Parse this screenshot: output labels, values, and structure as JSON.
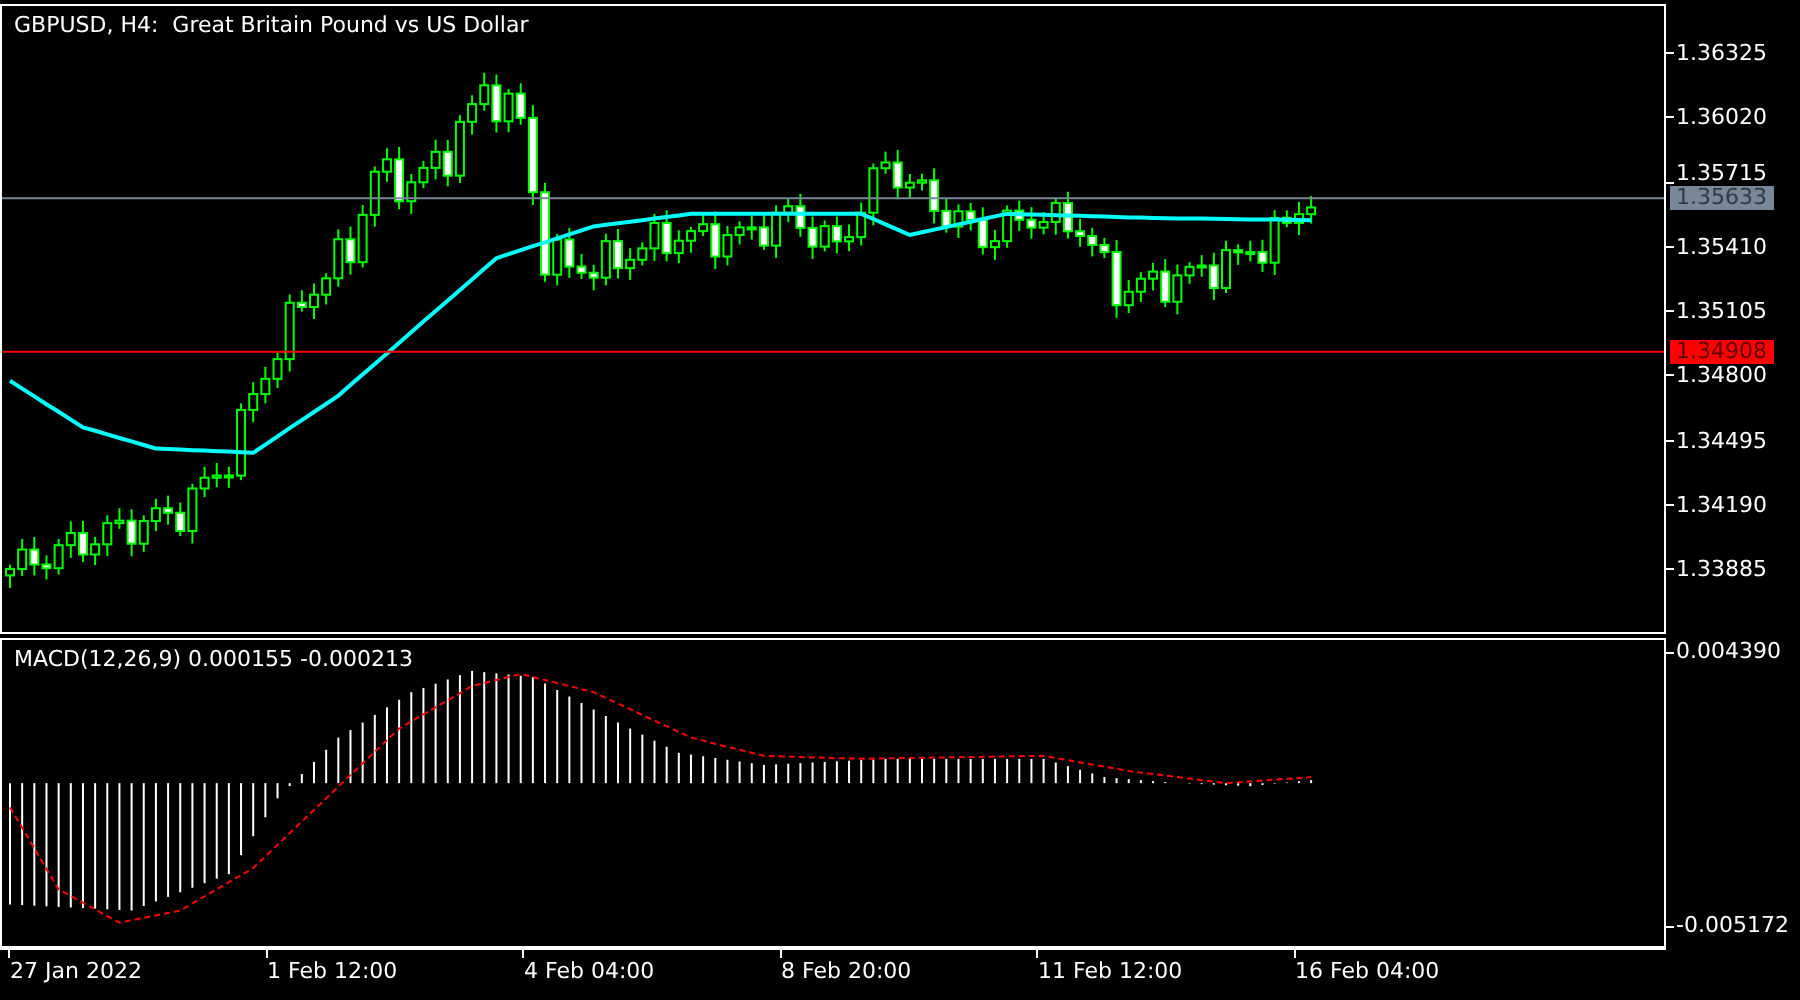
{
  "title": "GBPUSD, H4:  Great Britain Pound vs US Dollar",
  "price_axis": [
    "1.36325",
    "1.36020",
    "1.35715",
    "1.35410",
    "1.35105",
    "1.34800",
    "1.34495",
    "1.34190",
    "1.33885"
  ],
  "price_lines": [
    {
      "kind": "bid",
      "label": "1.35633"
    },
    {
      "kind": "level",
      "label": "1.34908"
    }
  ],
  "macd": {
    "label": "MACD(12,26,9) 0.000155 -0.000213",
    "ticks": [
      "0.004390",
      "-0.005172"
    ]
  },
  "time_axis": [
    "27 Jan 2022",
    "1 Feb 12:00",
    "4 Feb 04:00",
    "8 Feb 20:00",
    "11 Feb 12:00",
    "16 Feb 04:00"
  ]
}
